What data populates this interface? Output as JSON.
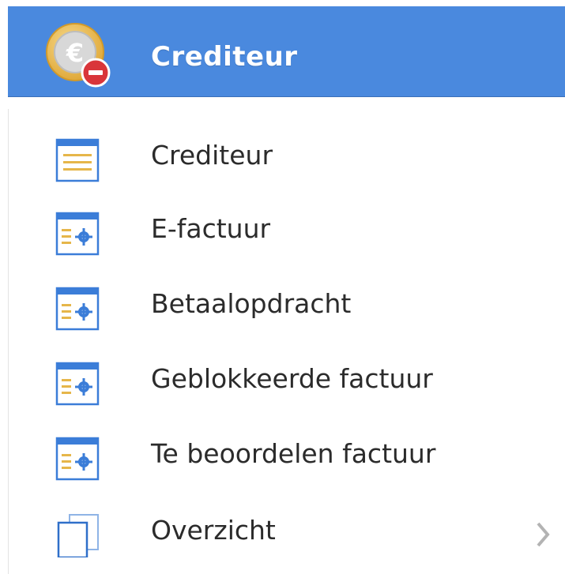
{
  "header": {
    "title": "Crediteur",
    "icon": "euro-coin-minus-icon",
    "accent_color": "#4a89de"
  },
  "menu": {
    "items": [
      {
        "label": "Crediteur",
        "icon": "list-document-icon"
      },
      {
        "label": "E-factuur",
        "icon": "settings-document-icon"
      },
      {
        "label": "Betaalopdracht",
        "icon": "settings-document-icon"
      },
      {
        "label": "Geblokkeerde factuur",
        "icon": "settings-document-icon"
      },
      {
        "label": "Te beoordelen factuur",
        "icon": "settings-document-icon"
      },
      {
        "label": "Overzicht",
        "icon": "copy-pages-icon",
        "has_submenu": true
      }
    ]
  }
}
